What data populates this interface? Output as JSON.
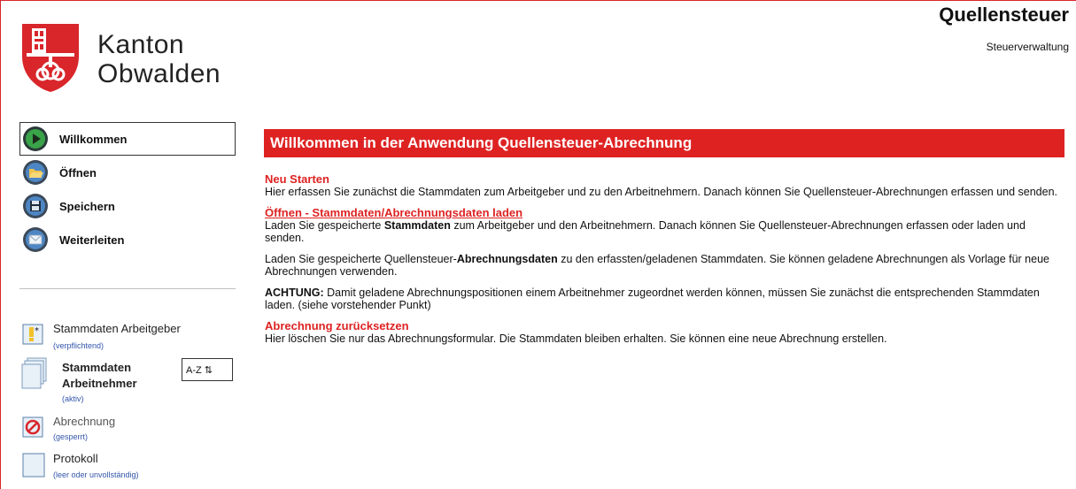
{
  "header": {
    "brand_line1": "Kanton",
    "brand_line2": "Obwalden",
    "app_title": "Quellensteuer",
    "app_subtitle": "Steuerverwaltung"
  },
  "nav": {
    "items": [
      {
        "label": "Willkommen",
        "icon": "play-icon",
        "active": true
      },
      {
        "label": "Öffnen",
        "icon": "folder-icon",
        "active": false
      },
      {
        "label": "Speichern",
        "icon": "floppy-icon",
        "active": false
      },
      {
        "label": "Weiterleiten",
        "icon": "mail-icon",
        "active": false
      }
    ]
  },
  "status": {
    "employer": {
      "title": "Stammdaten Arbeitgeber",
      "note": "(verpflichtend)"
    },
    "employees": {
      "title_line1": "Stammdaten",
      "title_line2": "Arbeitnehmer",
      "note": "(aktiv)",
      "sort_label": "A-Z ⇅"
    },
    "billing": {
      "title": "Abrechnung",
      "note": "(gesperrt)"
    },
    "protocol": {
      "title": "Protokoll",
      "note": "(leer oder unvollständig)"
    }
  },
  "main": {
    "banner": "Willkommen in der Anwendung Quellensteuer-Abrechnung",
    "sections": {
      "restart_title": "Neu Starten",
      "restart_text": "Hier erfassen Sie zunächst die Stammdaten zum Arbeitgeber und zu den Arbeitnehmern. Danach können Sie Quellensteuer-Abrechnungen erfassen und senden.",
      "open_title": "Öffnen - Stammdaten/Abrechnungsdaten laden",
      "open_text_a": "Laden Sie gespeicherte ",
      "open_text_bold": "Stammdaten",
      "open_text_b": " zum Arbeitgeber und den Arbeitnehmern. Danach können Sie Quellensteuer-Abrechnungen erfassen oder laden und senden.",
      "billing_text_a": "Laden Sie gespeicherte Quellensteuer-",
      "billing_text_bold": "Abrechnungsdaten",
      "billing_text_b": " zu den erfassten/geladenen Stammdaten. Sie können geladene Abrechnungen als Vorlage für neue Abrechnungen verwenden.",
      "attention_bold": "ACHTUNG:",
      "attention_text": " Damit geladene Abrechnungspositionen einem Arbeitnehmer zugeordnet werden können, müssen Sie zunächst die entsprechenden Stammdaten laden. (siehe vorstehender Punkt)",
      "reset_title": "Abrechnung zurücksetzen",
      "reset_text": "Hier löschen Sie nur das Abrechnungsformular. Die Stammdaten bleiben erhalten. Sie können eine neue Abrechnung erstellen."
    }
  },
  "colors": {
    "accent": "#de2222",
    "note_blue": "#3355aa"
  }
}
